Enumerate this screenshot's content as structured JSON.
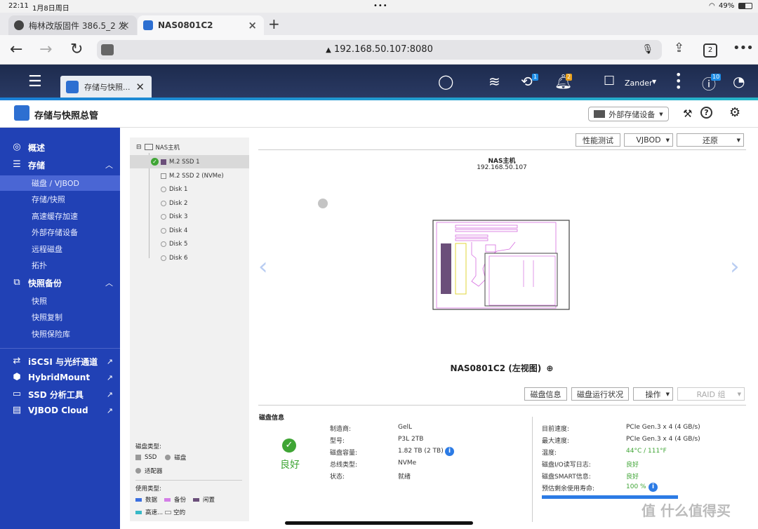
{
  "status_bar": {
    "time": "22:11",
    "date": "1月8日周日",
    "battery": "49%"
  },
  "browser": {
    "tabs": [
      {
        "title": "梅林改版固件 386.5_2 发"
      },
      {
        "title": "NAS0801C2"
      }
    ],
    "url": "192.168.50.107:8080",
    "tab_count": "2"
  },
  "qts": {
    "app_tab": "存储与快照...",
    "badges": {
      "tasks": "1",
      "notifications": "2",
      "info": "10"
    },
    "user": "Zander"
  },
  "app": {
    "title": "存储与快照总管",
    "external_device_button": "外部存储设备"
  },
  "sidebar": {
    "overview": "概述",
    "storage": "存储",
    "storage_items": [
      "磁盘 / VJBOD",
      "存储/快照",
      "高速缓存加速",
      "外部存储设备",
      "远程磁盘",
      "拓扑"
    ],
    "snapshot_backup": "快照备份",
    "snapshot_items": [
      "快照",
      "快照复制",
      "快照保险库"
    ],
    "links": [
      "iSCSI 与光纤通道",
      "HybridMount",
      "SSD 分析工具",
      "VJBOD Cloud"
    ]
  },
  "tree": {
    "root": "NAS主机",
    "nodes": [
      "M.2 SSD 1",
      "M.2 SSD 2 (NVMe)",
      "Disk 1",
      "Disk 2",
      "Disk 3",
      "Disk 4",
      "Disk 5",
      "Disk 6"
    ]
  },
  "legend": {
    "disk_type_title": "磁盘类型:",
    "disk_types": [
      "SSD",
      "磁盘",
      "适配器"
    ],
    "usage_title": "使用类型:",
    "usage_types": [
      "数据",
      "备份",
      "闲置",
      "高速...",
      "空的"
    ]
  },
  "toolbar": {
    "perf_test": "性能测试",
    "vjbod": "VJBOD",
    "restore": "还原"
  },
  "device": {
    "name": "NAS主机",
    "ip": "192.168.50.107",
    "view_caption": "NAS0801C2 (左视图)"
  },
  "actions": {
    "disk_info": "磁盘信息",
    "disk_health": "磁盘运行状况",
    "operate": "操作",
    "raid": "RAID 组"
  },
  "disk_info": {
    "section_title": "磁盘信息",
    "health_status": "良好",
    "left_fields": [
      {
        "label": "制造商:",
        "value": "GelL"
      },
      {
        "label": "型号:",
        "value": "P3L 2TB"
      },
      {
        "label": "磁盘容量:",
        "value": "1.82 TB (2 TB)"
      },
      {
        "label": "总线类型:",
        "value": "NVMe"
      },
      {
        "label": "状态:",
        "value": "就绪"
      }
    ],
    "right_fields": [
      {
        "label": "目前速度:",
        "value": "PCIe Gen.3 x 4 (4 GB/s)"
      },
      {
        "label": "最大速度:",
        "value": "PCIe Gen.3 x 4 (4 GB/s)"
      },
      {
        "label": "温度:",
        "value": "44°C / 111°F"
      },
      {
        "label": "磁盘I/O读写日志:",
        "value": "良好"
      },
      {
        "label": "磁盘SMART信息:",
        "value": "良好"
      },
      {
        "label": "预估剩余使用寿命:",
        "value": "100 %"
      }
    ],
    "life_percent": 100,
    "colors": {
      "ok": "#3fa535",
      "accent": "#2c7be5"
    }
  },
  "watermark": "值 什么值得买"
}
